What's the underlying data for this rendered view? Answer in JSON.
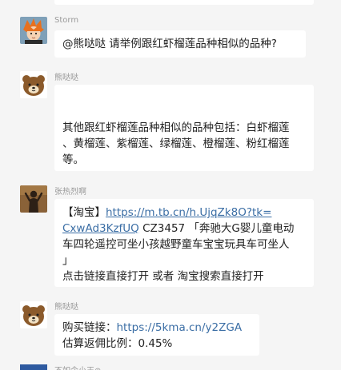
{
  "messages": [
    {
      "sender": "Storm",
      "lines": [
        "@熊哒哒 请举例跟红虾榴莲品种相似的品种?"
      ]
    },
    {
      "sender": "熊哒哒",
      "lines": [
        "其他跟红虾榴莲品种相似的品种包括：白虾榴莲",
        "、黄榴莲、紫榴莲、绿榴莲、橙榴莲、粉红榴莲",
        "等。"
      ]
    },
    {
      "sender": "张热烈啊",
      "prefix": "【淘宝】",
      "link_line1": "https://m.tb.cn/h.UjqZk8O?tk=",
      "link_line2": "CxwAd3KzfUQ",
      "code_text": " CZ3457 「奔驰大G婴儿童电动",
      "line3": "车四轮遥控可坐小孩越野童车宝宝玩具车可坐人",
      "line4": "」",
      "line5": "点击链接直接打开 或者 淘宝搜索直接打开"
    },
    {
      "sender": "熊哒哒",
      "buy_label": "购买链接：",
      "buy_link": "https://5kma.cn/y2ZGA",
      "rebate_line": "估算返佣比例：0.45%"
    }
  ],
  "next_sender_partial": "不如今小王⊕"
}
